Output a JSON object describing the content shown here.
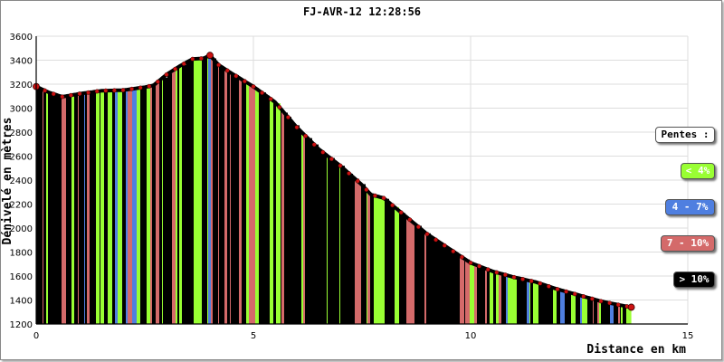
{
  "chart_data": {
    "type": "area",
    "title": "FJ-AVR-12 12:28:56",
    "xlabel": "Distance en km",
    "ylabel": "Dénivelé en mètres",
    "xlim": [
      0,
      15
    ],
    "ylim": [
      1200,
      3600
    ],
    "xticks": [
      "0",
      "5",
      "10",
      "15"
    ],
    "yticks": [
      "1200",
      "1400",
      "1600",
      "1800",
      "2000",
      "2200",
      "2400",
      "2600",
      "2800",
      "3000",
      "3200",
      "3400",
      "3600"
    ],
    "grid": true,
    "legend_position": "right",
    "legend": {
      "title": "Pentes :",
      "entries": [
        {
          "label": "< 4%",
          "color": "#99ff33",
          "text_color": "#ffffff"
        },
        {
          "label": "4 - 7%",
          "color": "#4f7fe0",
          "text_color": "#ffffff"
        },
        {
          "label": "7 - 10%",
          "color": "#d46a6a",
          "text_color": "#ffffff"
        },
        {
          "label": "> 10%",
          "color": "#000000",
          "text_color": "#ffffff"
        }
      ]
    },
    "series": [
      {
        "x": [
          0,
          0.3,
          0.6,
          1.0,
          1.5,
          2.0,
          2.5,
          2.7,
          3.0,
          3.3,
          3.6,
          3.85,
          4.0,
          4.2,
          4.5,
          5.0,
          5.5,
          6.0,
          6.5,
          7.0,
          7.5,
          7.7,
          8.0,
          8.5,
          9.0,
          9.5,
          10.0,
          10.5,
          11.0,
          11.5,
          12.0,
          12.5,
          13.0,
          13.4,
          13.7
        ],
        "y": [
          3180,
          3130,
          3095,
          3120,
          3145,
          3150,
          3175,
          3190,
          3280,
          3350,
          3410,
          3415,
          3440,
          3360,
          3290,
          3180,
          3050,
          2840,
          2660,
          2520,
          2360,
          2280,
          2250,
          2100,
          1950,
          1830,
          1710,
          1640,
          1590,
          1550,
          1490,
          1440,
          1390,
          1360,
          1340
        ]
      }
    ]
  },
  "colors": {
    "gentle": "#99ff33",
    "moderate": "#4f7fe0",
    "steep": "#d46a6a",
    "very_steep": "#000000",
    "marker": "#cc1111",
    "grid": "#dddddd"
  }
}
